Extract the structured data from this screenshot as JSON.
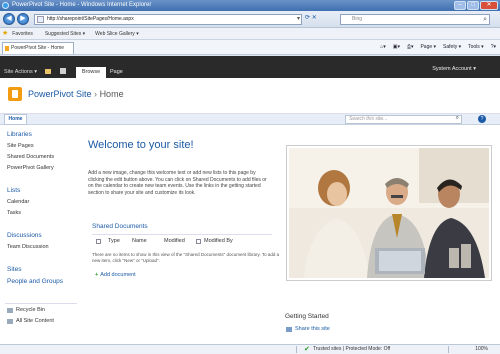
{
  "window": {
    "title": "PowerPivot Site - Home - Windows Internet Explorer"
  },
  "browser": {
    "url": "http://sharepoint/SitePages/Home.aspx",
    "search_placeholder": "Bing",
    "favorites_label": "Favorites",
    "suggested_sites": "Suggested Sites ▾",
    "web_slice_gallery": "Web Slice Gallery ▾",
    "tab_label": "PowerPivot Site - Home",
    "commands": [
      "Page ▾",
      "Safety ▾",
      "Tools ▾",
      "?▾"
    ]
  },
  "ribbon": {
    "site_actions": "Site Actions ▾",
    "browse_tab": "Browse",
    "page_tab": "Page",
    "system_account": "System Account ▾"
  },
  "site": {
    "title": "PowerPivot Site",
    "separator": "›",
    "current_page": "Home"
  },
  "topnav": {
    "home": "Home",
    "search_placeholder": "Search this site...",
    "help": "?"
  },
  "quicklaunch": {
    "libraries": "Libraries",
    "site_pages": "Site Pages",
    "shared_documents": "Shared Documents",
    "powerpivot_gallery": "PowerPivot Gallery",
    "lists": "Lists",
    "calendar": "Calendar",
    "tasks": "Tasks",
    "discussions": "Discussions",
    "team_discussion": "Team Discussion",
    "sites": "Sites",
    "people_and_groups": "People and Groups",
    "recycle_bin": "Recycle Bin",
    "all_site_content": "All Site Content"
  },
  "content": {
    "welcome": "Welcome to your site!",
    "intro": "Add a new image, change this welcome text or add new lists to this page by clicking the edit button above. You can click on Shared Documents to add files or on the calendar to create new team events. Use the links in the getting started section to share your site and customize its look.",
    "shared_documents_title": "Shared Documents",
    "columns": [
      "Type",
      "Name",
      "Modified",
      "Modified By"
    ],
    "empty_message": "There are no items to show in this view of the \"Shared Documents\" document library. To add a new item, click \"New\" or \"Upload\".",
    "add_document": "Add document",
    "getting_started": "Getting Started",
    "share_this_site": "Share this site"
  },
  "statusbar": {
    "zone": "Trusted sites | Protected Mode: Off",
    "zoom": "100%"
  }
}
